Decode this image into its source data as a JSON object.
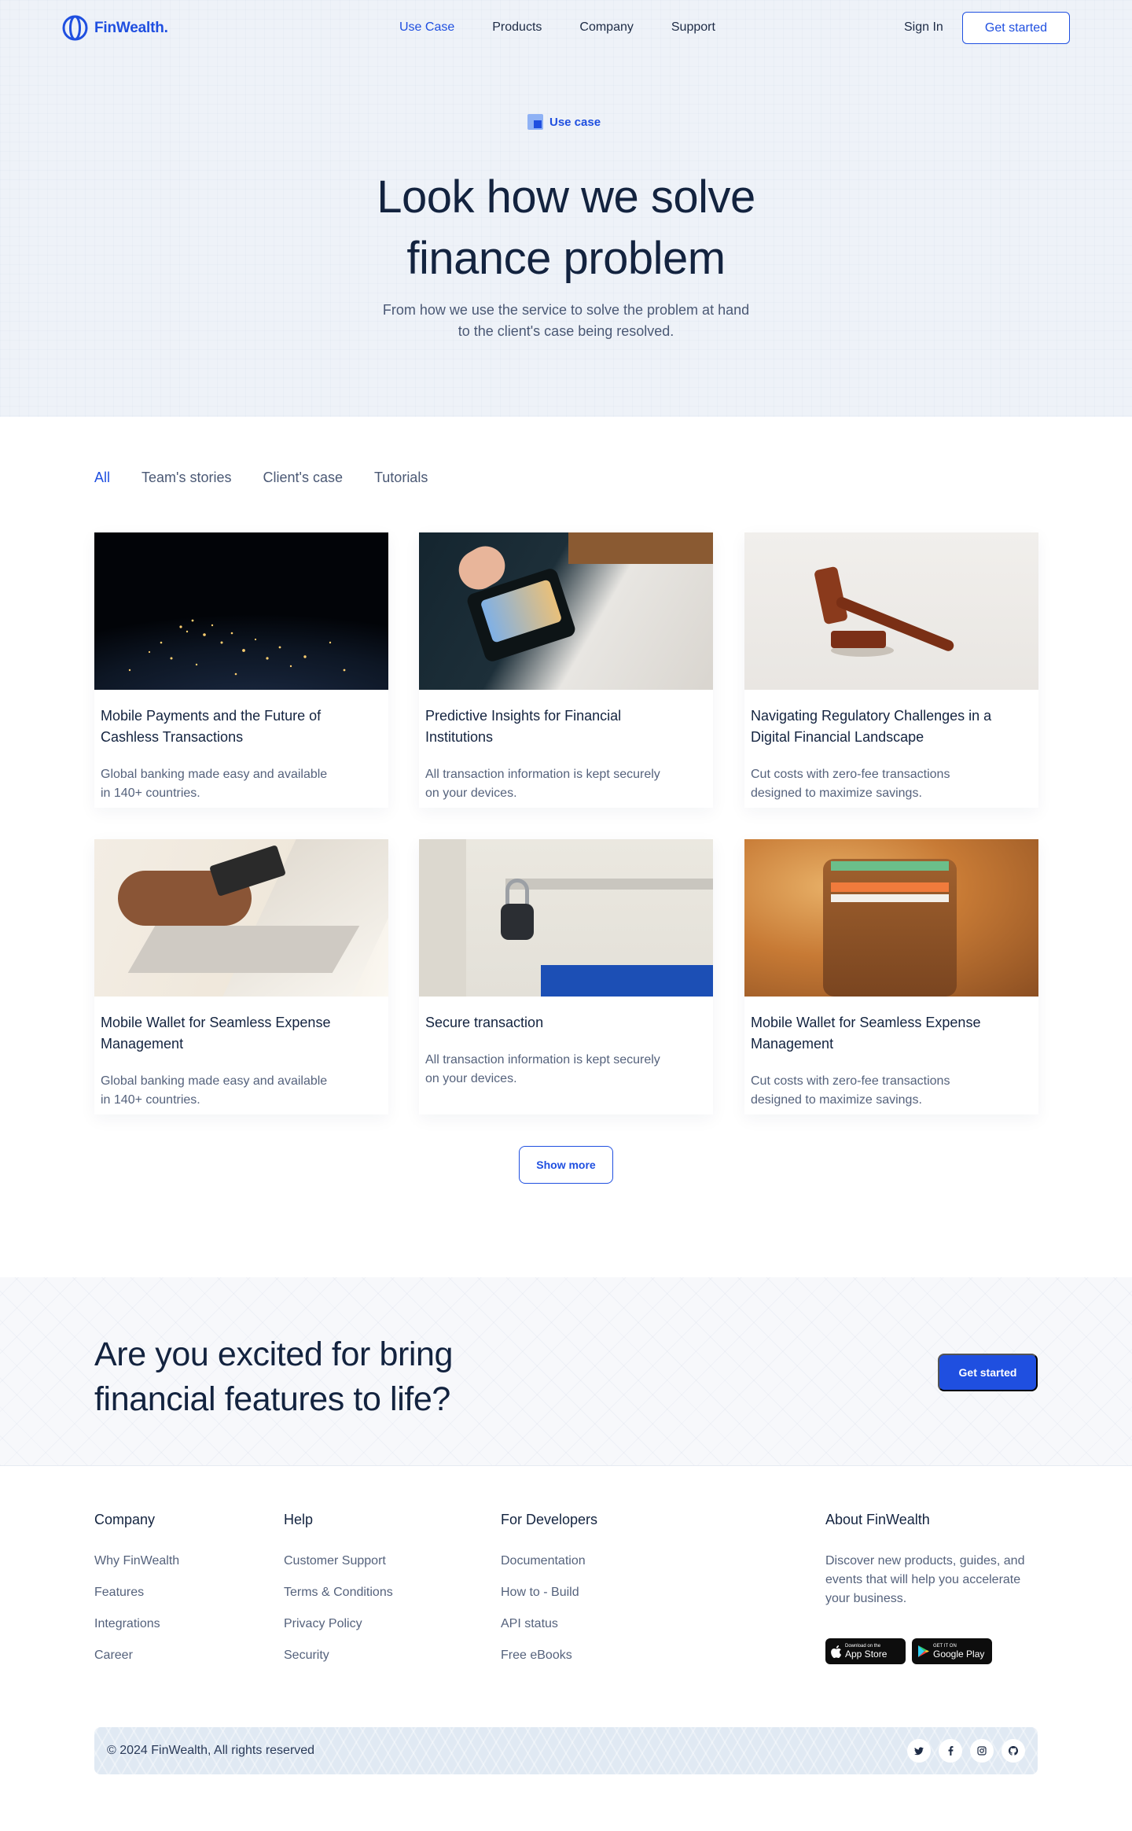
{
  "brand": {
    "name": "FinWealth.",
    "accent": "#1f4fe0"
  },
  "nav": {
    "links": [
      "Use Case",
      "Products",
      "Company",
      "Support"
    ],
    "active": "Use Case",
    "signin_label": "Sign In",
    "cta_label": "Get started"
  },
  "hero": {
    "badge": "Use case",
    "title_line1": "Look how we solve",
    "title_line2": "finance problem",
    "subtitle": "From how we use the service to solve the problem at hand to the client's case being resolved."
  },
  "filters": [
    "All",
    "Team's stories",
    "Client's case",
    "Tutorials"
  ],
  "cards": [
    {
      "title": "Mobile Payments and the Future of Cashless Transactions",
      "desc": "Global banking made easy and available in 140+ countries.",
      "image": "earth-night-lights"
    },
    {
      "title": "Predictive Insights for Financial Institutions",
      "desc": "All transaction information is kept securely on your devices.",
      "image": "phone-card-terminal"
    },
    {
      "title": "Navigating Regulatory Challenges in a Digital Financial Landscape",
      "desc": "Cut costs with zero-fee transactions designed to maximize savings.",
      "image": "judge-gavel"
    },
    {
      "title": "Mobile Wallet for Seamless Expense Management",
      "desc": "Global banking made easy and available in 140+ countries.",
      "image": "card-laptop-payment"
    },
    {
      "title": "Secure transaction",
      "desc": "All transaction information is kept securely on your devices.",
      "image": "padlock-door"
    },
    {
      "title": "Mobile Wallet for Seamless Expense Management",
      "desc": "Cut costs with zero-fee transactions designed to maximize savings.",
      "image": "leather-wallet-cards"
    }
  ],
  "show_more_label": "Show more",
  "cta": {
    "title": "Are you excited for bring financial features to life?",
    "button_label": "Get started"
  },
  "footer": {
    "company": {
      "heading": "Company",
      "links": [
        "Why FinWealth",
        "Features",
        "Integrations",
        "Career"
      ]
    },
    "help": {
      "heading": "Help",
      "links": [
        "Customer Support",
        "Terms & Conditions",
        "Privacy Policy",
        "Security"
      ]
    },
    "developers": {
      "heading": "For Developers",
      "links": [
        "Documentation",
        "How to - Build",
        "API status",
        "Free eBooks"
      ]
    },
    "about": {
      "heading": "About FinWealth",
      "text": "Discover new products, guides, and events that will help you accelerate your business."
    },
    "stores": [
      {
        "small": "Download on the",
        "big": "App Store",
        "icon": "apple-icon"
      },
      {
        "small": "GET IT ON",
        "big": "Google Play",
        "icon": "google-play-icon"
      }
    ],
    "copyright": "© 2024 FinWealth, All rights reserved",
    "socials": [
      "twitter-icon",
      "facebook-icon",
      "instagram-icon",
      "github-icon"
    ]
  }
}
